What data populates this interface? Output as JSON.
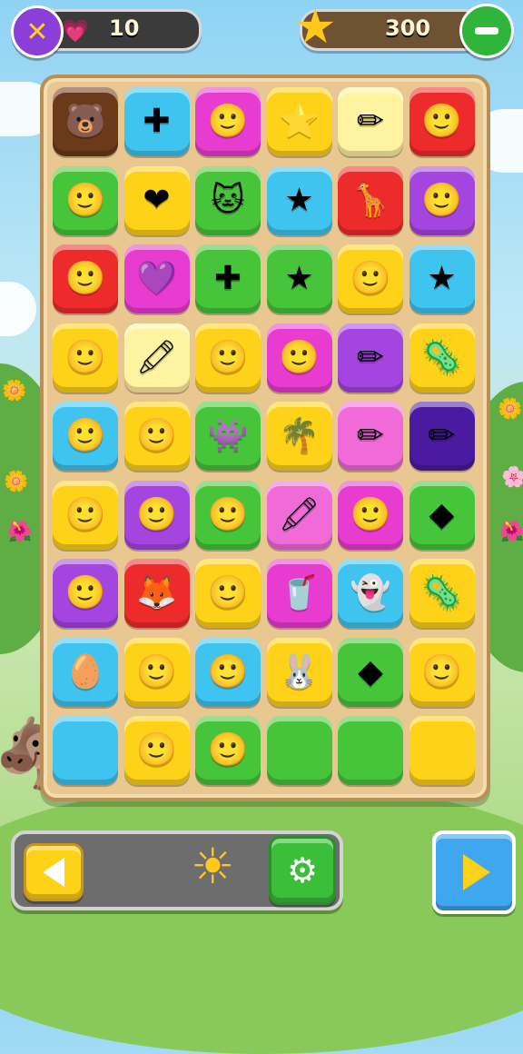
{
  "hud": {
    "lives": {
      "value": "10",
      "icon": "heart-gem-icon"
    },
    "score": {
      "value": "300",
      "icon": "star-face-icon"
    },
    "close_icon": "close-icon",
    "minus_icon": "minus-icon"
  },
  "board": {
    "rows": [
      [
        {
          "c": "brown",
          "s": "🐻"
        },
        {
          "c": "cyan",
          "s": "✚"
        },
        {
          "c": "magenta",
          "s": "🙂"
        },
        {
          "c": "yellow",
          "s": "⭐"
        },
        {
          "c": "paleyellow",
          "s": "✏"
        },
        {
          "c": "red",
          "s": "🙂"
        }
      ],
      [
        {
          "c": "green",
          "s": "🙂"
        },
        {
          "c": "yellow",
          "s": "❤"
        },
        {
          "c": "green",
          "s": "🐱"
        },
        {
          "c": "cyan",
          "s": "★"
        },
        {
          "c": "red",
          "s": "🦒"
        },
        {
          "c": "purple",
          "s": "🙂"
        }
      ],
      [
        {
          "c": "red",
          "s": "🙂"
        },
        {
          "c": "magenta",
          "s": "💜"
        },
        {
          "c": "green",
          "s": "✚"
        },
        {
          "c": "green",
          "s": "★"
        },
        {
          "c": "yellow",
          "s": "🙂"
        },
        {
          "c": "cyan",
          "s": "★"
        }
      ],
      [
        {
          "c": "yellow",
          "s": "🙂"
        },
        {
          "c": "paleyellow",
          "s": "🖍"
        },
        {
          "c": "yellow",
          "s": "🙂"
        },
        {
          "c": "magenta",
          "s": "🙂"
        },
        {
          "c": "purple",
          "s": "✏"
        },
        {
          "c": "yellow",
          "s": "🦠"
        }
      ],
      [
        {
          "c": "cyan",
          "s": "🙂"
        },
        {
          "c": "yellow",
          "s": "🙂"
        },
        {
          "c": "green",
          "s": "👾"
        },
        {
          "c": "yellow",
          "s": "🌴"
        },
        {
          "c": "pink",
          "s": "✏"
        },
        {
          "c": "violet",
          "s": "✏"
        }
      ],
      [
        {
          "c": "yellow",
          "s": "🙂"
        },
        {
          "c": "purple",
          "s": "🙂"
        },
        {
          "c": "green",
          "s": "🙂"
        },
        {
          "c": "pink",
          "s": "🖍"
        },
        {
          "c": "magenta",
          "s": "🙂"
        },
        {
          "c": "green",
          "s": "◆"
        }
      ],
      [
        {
          "c": "purple",
          "s": "🙂"
        },
        {
          "c": "red",
          "s": "🦊"
        },
        {
          "c": "yellow",
          "s": "🙂"
        },
        {
          "c": "magenta",
          "s": "🥤"
        },
        {
          "c": "cyan",
          "s": "👻"
        },
        {
          "c": "yellow",
          "s": "🦠"
        }
      ],
      [
        {
          "c": "cyan",
          "s": "🥚"
        },
        {
          "c": "yellow",
          "s": "🙂"
        },
        {
          "c": "cyan",
          "s": "🙂"
        },
        {
          "c": "yellow",
          "s": "🐰"
        },
        {
          "c": "green",
          "s": "◆"
        },
        {
          "c": "yellow",
          "s": "🙂"
        }
      ],
      [
        {
          "c": "cyan",
          "s": ""
        },
        {
          "c": "yellow",
          "s": "🙂"
        },
        {
          "c": "green",
          "s": "🙂"
        },
        {
          "c": "green",
          "s": ""
        },
        {
          "c": "green",
          "s": ""
        },
        {
          "c": "yellow",
          "s": ""
        }
      ]
    ]
  },
  "colors": {
    "brown": "#6b3a1a",
    "cyan": "#3fc4f0",
    "magenta": "#e83cd0",
    "yellow": "#ffd21a",
    "paleyellow": "#fff2a0",
    "red": "#ee2b2b",
    "green": "#46c53a",
    "purple": "#a445e0",
    "pink": "#f06ad8",
    "violet": "#4a1aa0"
  },
  "controls": {
    "back_icon": "left-arrow-icon",
    "sun_icon": "sun-icon",
    "settings_icon": "gear-icon",
    "play_icon": "play-icon"
  }
}
